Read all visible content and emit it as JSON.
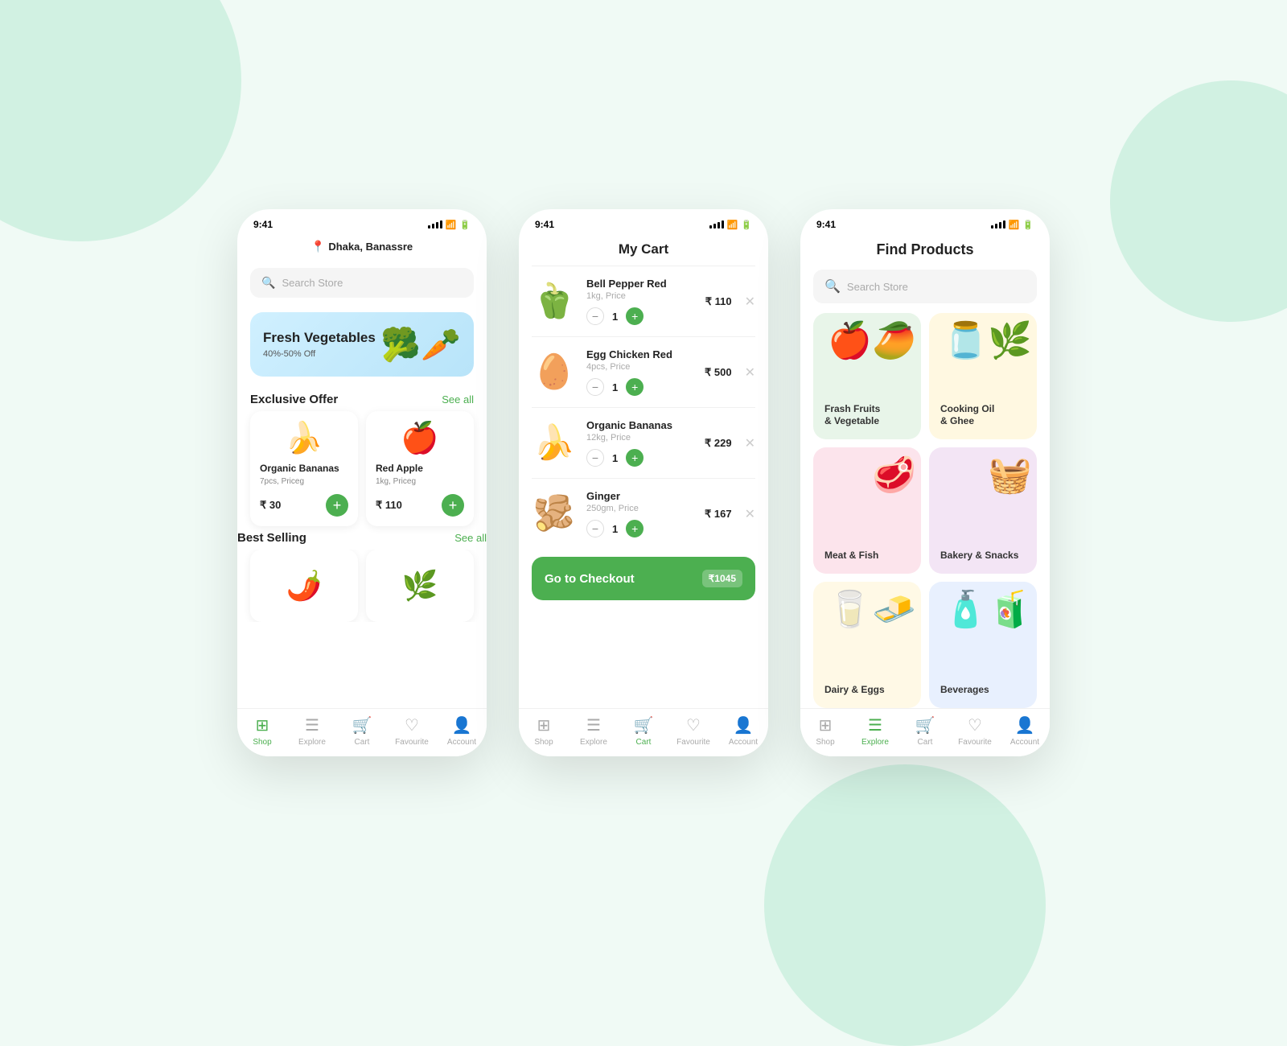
{
  "background": {
    "color": "#edfaf3"
  },
  "phone1": {
    "status_time": "9:41",
    "location": "Dhaka, Banassre",
    "search_placeholder": "Search Store",
    "banner": {
      "title": "Fresh Vegetables",
      "subtitle": "40%-50% Off",
      "emoji": "🛒🥦🥕"
    },
    "exclusive_offer": {
      "label": "Exclusive Offer",
      "see_all": "See all",
      "products": [
        {
          "emoji": "🍌",
          "name": "Organic Bananas",
          "desc": "7pcs, Priceg",
          "price": "₹ 30"
        },
        {
          "emoji": "🍎",
          "name": "Red Apple",
          "desc": "1kg, Priceg",
          "price": "₹ 110"
        }
      ]
    },
    "best_selling": {
      "label": "Best Selling",
      "see_all": "See all",
      "products": [
        {
          "emoji": "🌶️"
        },
        {
          "emoji": "🌿"
        }
      ]
    },
    "nav": [
      {
        "label": "Shop",
        "active": true
      },
      {
        "label": "Explore",
        "active": false
      },
      {
        "label": "Cart",
        "active": false
      },
      {
        "label": "Favourite",
        "active": false
      },
      {
        "label": "Account",
        "active": false
      }
    ]
  },
  "phone2": {
    "status_time": "9:41",
    "title": "My Cart",
    "items": [
      {
        "emoji": "🫑",
        "name": "Bell Pepper Red",
        "sub": "1kg, Price",
        "qty": "1",
        "price": "₹ 110"
      },
      {
        "emoji": "🥚",
        "name": "Egg Chicken Red",
        "sub": "4pcs, Price",
        "qty": "1",
        "price": "₹ 500"
      },
      {
        "emoji": "🍌",
        "name": "Organic Bananas",
        "sub": "12kg, Price",
        "qty": "1",
        "price": "₹ 229"
      },
      {
        "emoji": "🫚",
        "name": "Ginger",
        "sub": "250gm, Price",
        "qty": "1",
        "price": "₹ 167"
      }
    ],
    "checkout_label": "Go to Checkout",
    "checkout_amount": "₹1045",
    "nav": [
      {
        "label": "Shop",
        "active": false
      },
      {
        "label": "Explore",
        "active": false
      },
      {
        "label": "Cart",
        "active": true
      },
      {
        "label": "Favourite",
        "active": false
      },
      {
        "label": "Account",
        "active": false
      }
    ]
  },
  "phone3": {
    "status_time": "9:41",
    "title": "Find Products",
    "search_placeholder": "Search Store",
    "categories": [
      {
        "label": "Frash Fruits\n& Vegetable",
        "emoji": "🍎🥭",
        "class": "cat-fruits"
      },
      {
        "label": "Cooking Oil\n& Ghee",
        "emoji": "🫙",
        "class": "cat-oil"
      },
      {
        "label": "Meat & Fish",
        "emoji": "🥩",
        "class": "cat-meat"
      },
      {
        "label": "Bakery & Snacks",
        "emoji": "🧺",
        "class": "cat-bakery"
      },
      {
        "label": "Dairy & Eggs",
        "emoji": "🥛",
        "class": "cat-dairy"
      },
      {
        "label": "Beverages",
        "emoji": "🧴",
        "class": "cat-beverages"
      }
    ],
    "nav": [
      {
        "label": "Shop",
        "active": false
      },
      {
        "label": "Explore",
        "active": true
      },
      {
        "label": "Cart",
        "active": false
      },
      {
        "label": "Favourite",
        "active": false
      },
      {
        "label": "Account",
        "active": false
      }
    ]
  }
}
